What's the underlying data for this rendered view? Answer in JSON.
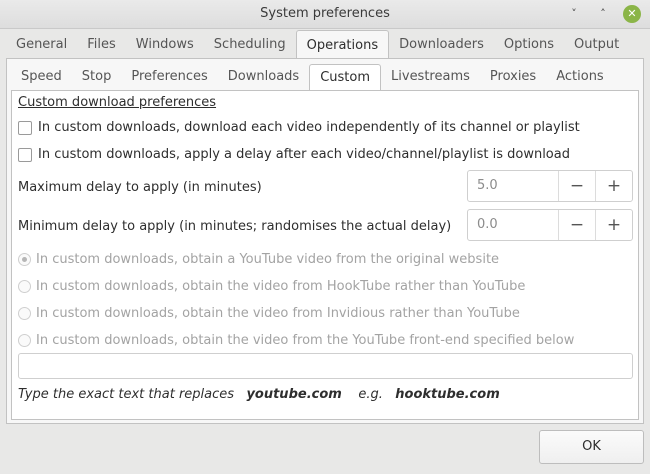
{
  "window": {
    "title": "System preferences",
    "controls": {
      "minimize": "˅",
      "maximize": "˄",
      "close": "✕"
    }
  },
  "main_tabs": [
    "General",
    "Files",
    "Windows",
    "Scheduling",
    "Operations",
    "Downloaders",
    "Options",
    "Output"
  ],
  "main_tabs_active": "Operations",
  "sub_tabs": [
    "Speed",
    "Stop",
    "Preferences",
    "Downloads",
    "Custom",
    "Livestreams",
    "Proxies",
    "Actions"
  ],
  "sub_tabs_active": "Custom",
  "custom": {
    "section_title": "Custom download preferences",
    "checkbox_independent": "In custom downloads, download each video independently of its channel or playlist",
    "checkbox_delay": "In custom downloads, apply a delay after each video/channel/playlist is download",
    "max_delay_label": "Maximum delay to apply (in minutes)",
    "max_delay_value": "5.0",
    "min_delay_label": "Minimum delay to apply (in minutes; randomises the actual delay)",
    "min_delay_value": "0.0",
    "spin_minus": "−",
    "spin_plus": "+",
    "radio_original": "In custom downloads, obtain a YouTube video from the original website",
    "radio_hooktube": "In custom downloads, obtain the video from HookTube rather than YouTube",
    "radio_invidious": "In custom downloads, obtain the video from Invidious rather than YouTube",
    "radio_frontend": "In custom downloads, obtain the video from the YouTube front-end specified below",
    "frontend_value": "",
    "hint_prefix": "Type the exact text that replaces",
    "hint_domain": "youtube.com",
    "hint_eg": "e.g.",
    "hint_example": "hooktube.com"
  },
  "ok_label": "OK"
}
